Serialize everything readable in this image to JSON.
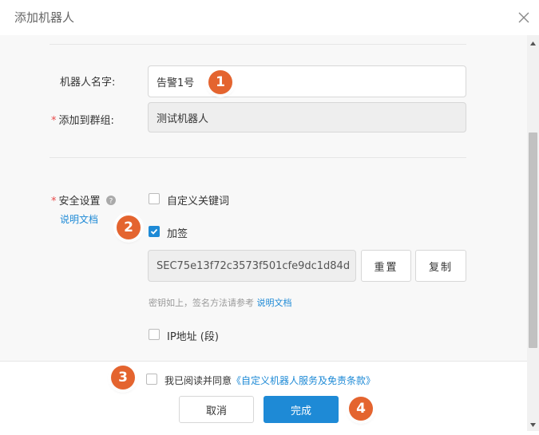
{
  "dialog": {
    "title": "添加机器人"
  },
  "form": {
    "robot_name_label": "机器人名字:",
    "robot_name_value": "告警1号",
    "group_required_mark": "*",
    "group_label": "添加到群组:",
    "group_value": "测试机器人",
    "security_required_mark": "*",
    "security_label": "安全设置",
    "security_help_link": "说明文档",
    "keyword_option": "自定义关键词",
    "sign_option": "加签",
    "secret_value": "SEC75e13f72c3573f501cfe9dc1d84d",
    "reset_button": "重置",
    "copy_button": "复制",
    "hint_text": "密钥如上，签名方法请参考",
    "hint_link": "说明文档",
    "ip_option": "IP地址 (段)"
  },
  "footer": {
    "agree_text": "我已阅读并同意",
    "agree_link": "《自定义机器人服务及免责条款》",
    "cancel_button": "取消",
    "confirm_button": "完成"
  },
  "annotations": [
    "1",
    "2",
    "3",
    "4"
  ],
  "colors": {
    "accent": "#1e8ad6",
    "badge": "#e4642f",
    "required": "#e84a4a"
  }
}
